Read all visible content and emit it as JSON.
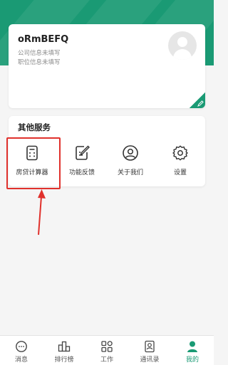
{
  "profile": {
    "username": "oRmBEFQ",
    "company": "公司信息未填写",
    "position": "职位信息未填写"
  },
  "services": {
    "title": "其他服务",
    "items": [
      {
        "label": "房贷计算器",
        "icon": "calculator-icon"
      },
      {
        "label": "功能反馈",
        "icon": "feedback-icon"
      },
      {
        "label": "关于我们",
        "icon": "about-icon"
      },
      {
        "label": "设置",
        "icon": "gear-icon"
      }
    ]
  },
  "tabbar": {
    "active": "我的",
    "items": [
      {
        "label": "消息",
        "icon": "message-icon"
      },
      {
        "label": "排行榜",
        "icon": "ranking-icon"
      },
      {
        "label": "工作",
        "icon": "work-grid-icon"
      },
      {
        "label": "通讯录",
        "icon": "contacts-icon"
      },
      {
        "label": "我的",
        "icon": "profile-icon"
      }
    ]
  },
  "colors": {
    "brand": "#1a9a74",
    "highlight": "#e0312c"
  }
}
